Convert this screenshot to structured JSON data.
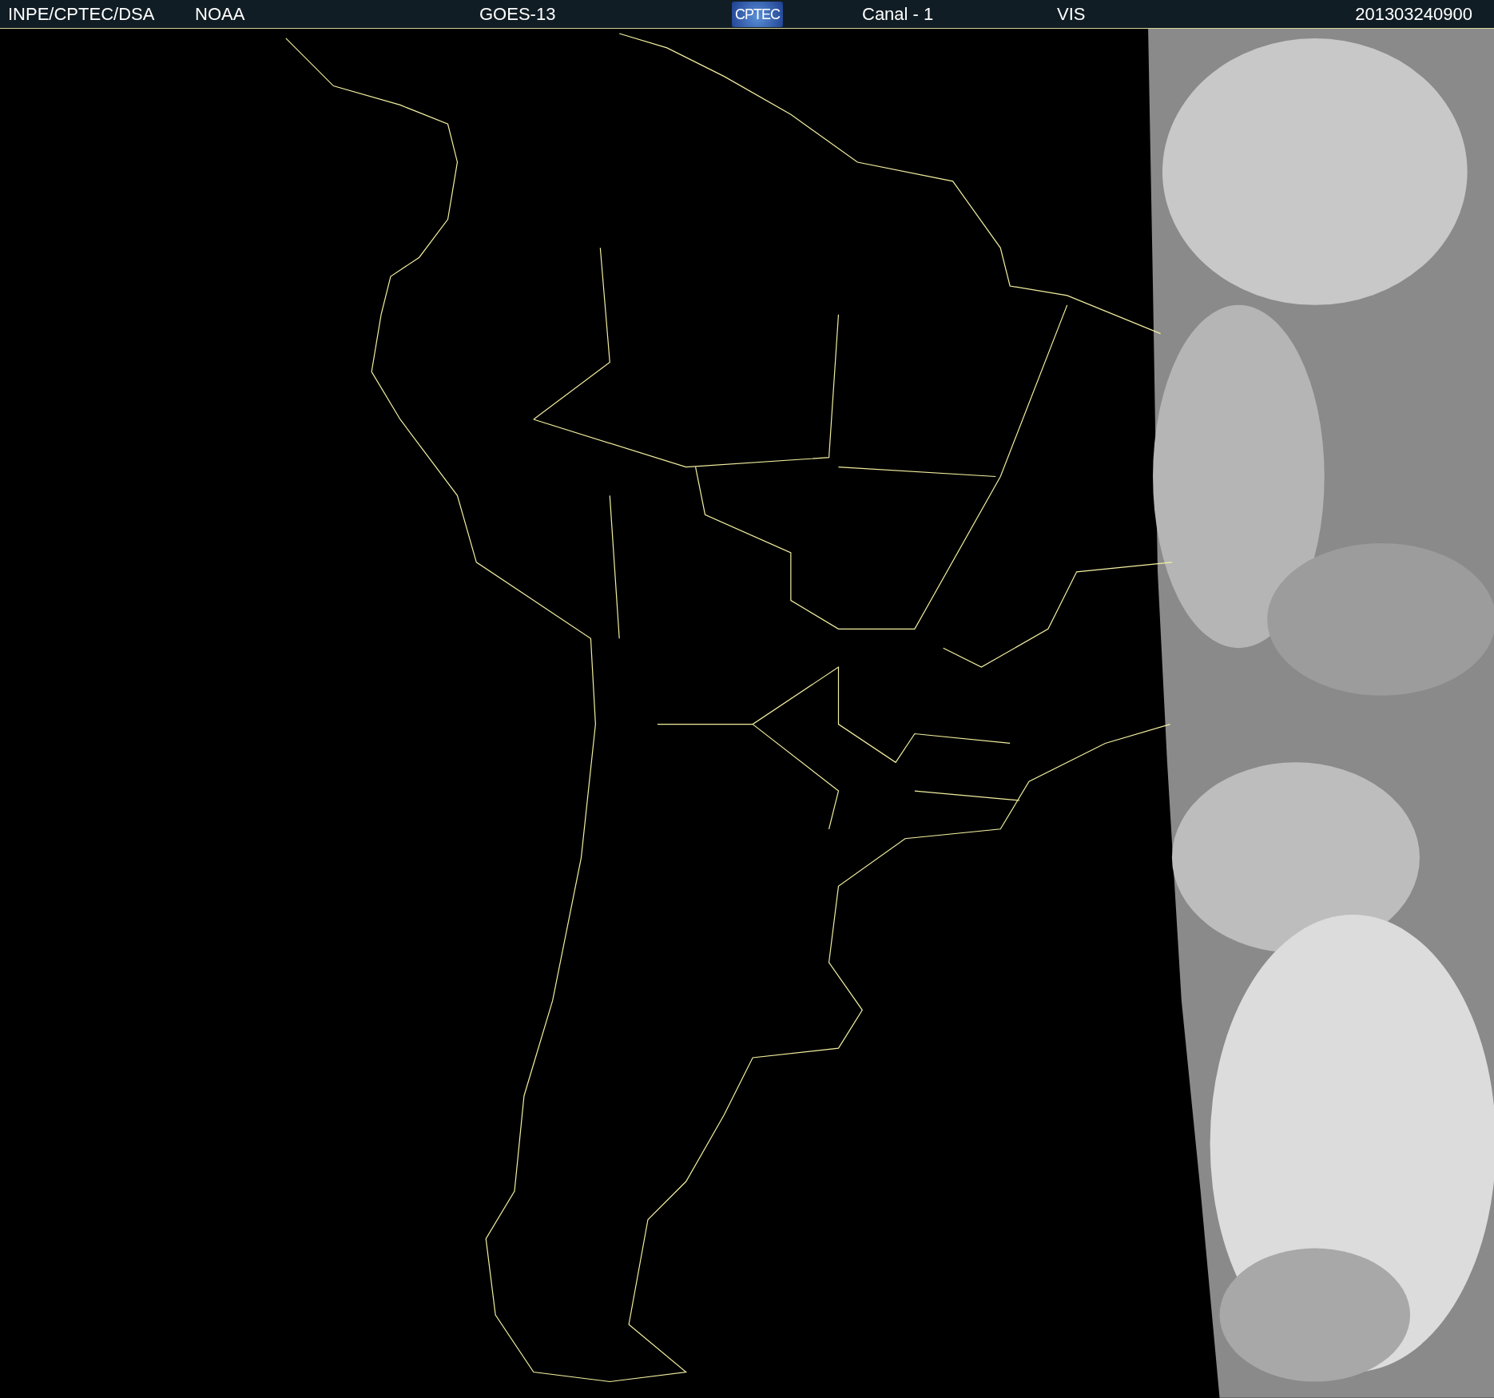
{
  "header": {
    "items": [
      {
        "kind": "text",
        "text": "INPE/CPTEC/DSA"
      },
      {
        "kind": "text",
        "text": "NOAA"
      },
      {
        "kind": "text",
        "text": "GOES-13"
      },
      {
        "kind": "logo",
        "text": "CPTEC"
      },
      {
        "kind": "text",
        "text": "Canal - 1"
      },
      {
        "kind": "text",
        "text": "VIS"
      },
      {
        "kind": "text",
        "text": "201303240900"
      }
    ]
  }
}
